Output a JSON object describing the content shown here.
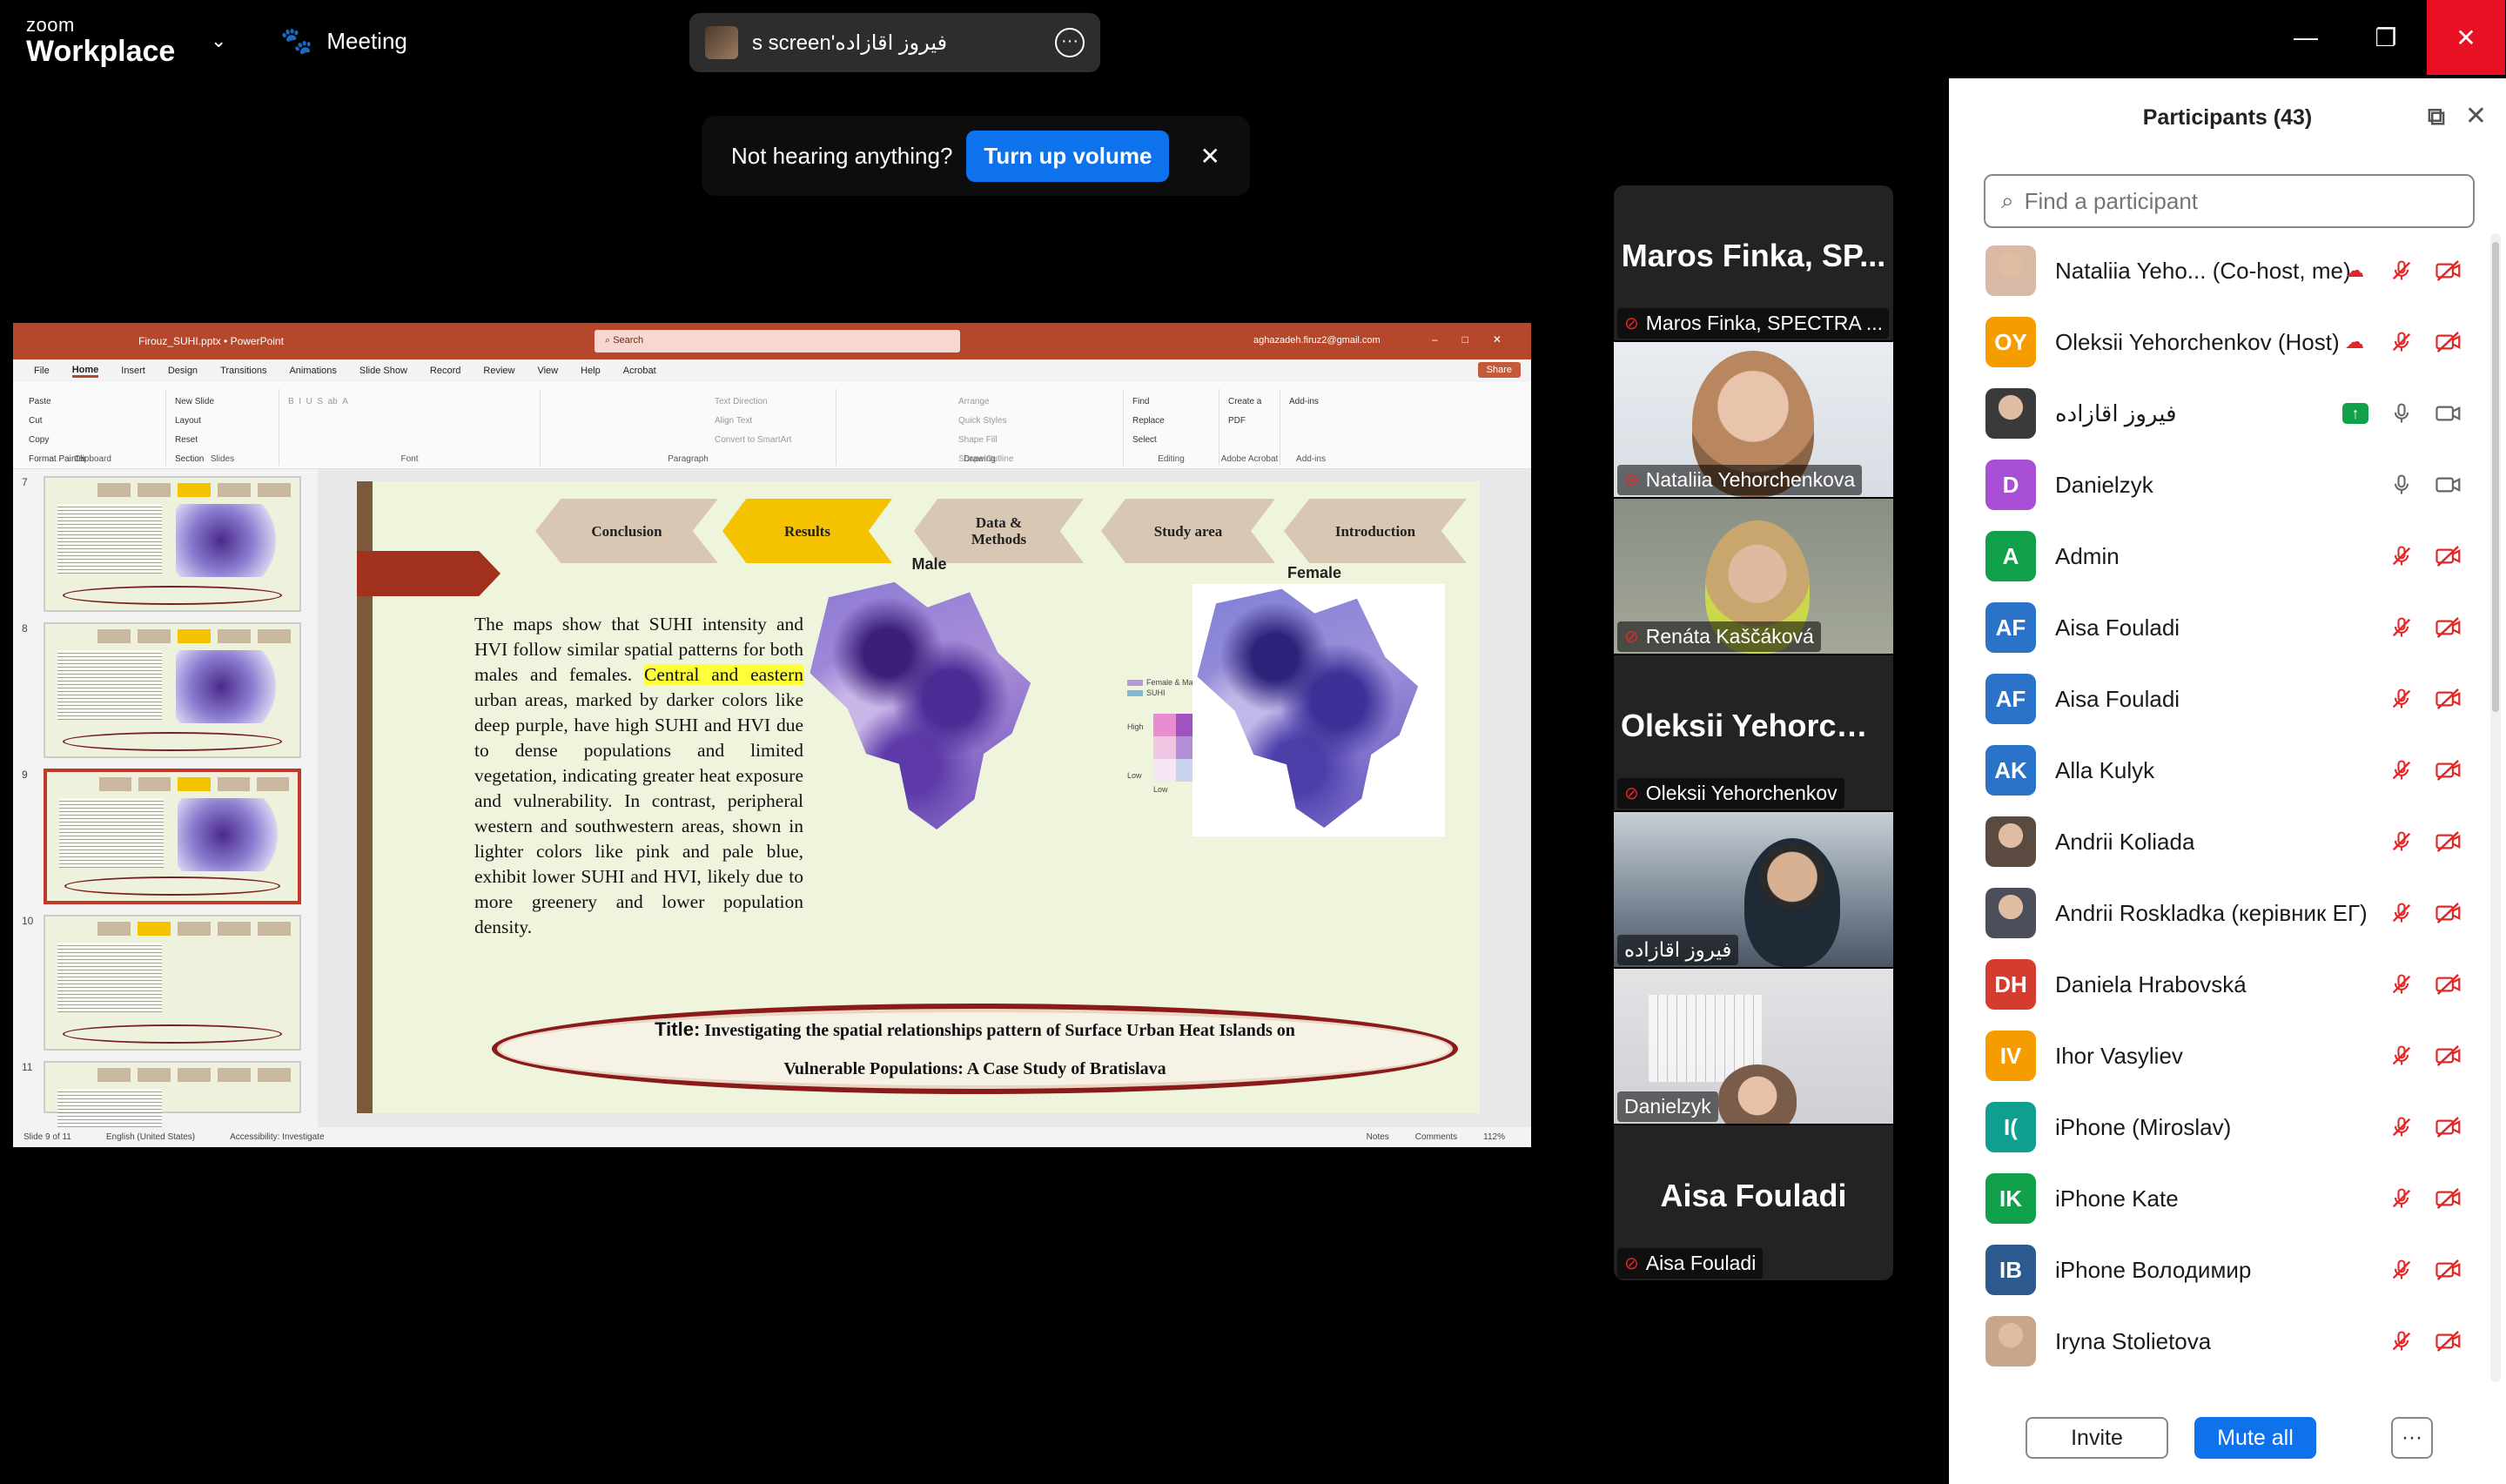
{
  "topbar": {
    "brand_small": "zoom",
    "brand_big": "Workplace",
    "meeting_label": "Meeting",
    "share_label": "فیروز اقازاده's screen",
    "more_glyph": "···"
  },
  "toast": {
    "message": "Not hearing anything?",
    "action": "Turn up volume",
    "close": "✕"
  },
  "ppt": {
    "filename": "Firouz_SUHI.pptx • PowerPoint",
    "search_placeholder": "Search",
    "account": "aghazadeh.firuz2@gmail.com",
    "share": "Share",
    "menu": [
      "File",
      "Home",
      "Insert",
      "Design",
      "Transitions",
      "Animations",
      "Slide Show",
      "Record",
      "Review",
      "View",
      "Help",
      "Acrobat"
    ],
    "ribbon": {
      "clipboard": {
        "label": "Clipboard",
        "items": [
          "Paste",
          "Cut",
          "Copy",
          "Format Painter"
        ]
      },
      "slides": {
        "label": "Slides",
        "items": [
          "New Slide",
          "Layout",
          "Reset",
          "Section"
        ]
      },
      "font": {
        "label": "Font"
      },
      "paragraph": {
        "label": "Paragraph",
        "items": [
          "Text Direction",
          "Align Text",
          "Convert to SmartArt"
        ]
      },
      "drawing": {
        "label": "Drawing",
        "items": [
          "Arrange",
          "Quick Styles",
          "Shape Fill",
          "Shape Outline",
          "Shape Effects"
        ]
      },
      "editing": {
        "label": "Editing",
        "items": [
          "Find",
          "Replace",
          "Select"
        ]
      },
      "acrobat": {
        "label": "Adobe Acrobat",
        "items": [
          "Create a PDF"
        ]
      },
      "addins": {
        "label": "Add-ins",
        "items": [
          "Add-ins"
        ]
      }
    },
    "thumb_numbers": [
      "7",
      "8",
      "9",
      "10",
      "11"
    ],
    "slide": {
      "tabs": [
        "Conclusion",
        "Results",
        "Data & Methods",
        "Study area",
        "Introduction"
      ],
      "body_before": "The maps show that SUHI intensity and HVI follow similar spatial patterns for both males and females. ",
      "body_highlight": "Central and eastern",
      "body_after": " urban areas, marked by darker colors like deep purple, have high SUHI and HVI due to dense populations and limited vegetation, indicating greater heat exposure and vulnerability. In contrast, peripheral western and southwestern areas, shown in lighter colors like pink and pale blue, exhibit lower SUHI and HVI, likely due to more greenery and lower population density.",
      "map_male": "Male",
      "map_female": "Female",
      "legend_a": "Female & Male",
      "legend_b": "SUHI",
      "legend_high": "High",
      "legend_low": "Low",
      "title_key": "Title:",
      "title_line1": "Investigating the spatial relationships pattern of Surface Urban Heat Islands on",
      "title_line2": "Vulnerable Populations: A Case Study of Bratislava"
    },
    "status": {
      "slide": "Slide 9 of 11",
      "lang": "English (United States)",
      "access": "Accessibility: Investigate",
      "notes": "Notes",
      "comments": "Comments",
      "zoom": "112%"
    }
  },
  "tiles": [
    {
      "big": "Maros Finka, SP...",
      "name": "Maros Finka, SPECTRA ...",
      "muted": true
    },
    {
      "name": "Nataliia Yehorchenkova",
      "muted": true
    },
    {
      "name": "Renáta Kaščáková",
      "muted": true
    },
    {
      "big": "Oleksii  Yehorche...",
      "name": "Oleksii Yehorchenkov",
      "muted": true
    },
    {
      "name": "فیروز اقازاده",
      "muted": false
    },
    {
      "name": "Danielzyk",
      "muted": false
    },
    {
      "big": "Aisa Fouladi",
      "name": "Aisa Fouladi",
      "muted": true
    }
  ],
  "panel": {
    "title": "Participants (43)",
    "search_placeholder": "Find a participant",
    "invite": "Invite",
    "mute_all": "Mute all",
    "more": "···",
    "participants": [
      {
        "name": "Nataliia Yeho...  (Co-host, me)",
        "initials": "",
        "color": "#d7b9a5",
        "photo": true,
        "extra": "cloud",
        "mic": "muted",
        "cam": "off"
      },
      {
        "name": "Oleksii Yehorchenkov (Host)",
        "initials": "OY",
        "color": "#f59c00",
        "extra": "cloud",
        "mic": "muted",
        "cam": "off"
      },
      {
        "name": "فیروز اقازاده",
        "initials": "",
        "color": "#3a3a3a",
        "photo": true,
        "extra": "share",
        "mic": "on",
        "cam": "on"
      },
      {
        "name": "Danielzyk",
        "initials": "D",
        "color": "#a94fd6",
        "mic": "on",
        "cam": "on"
      },
      {
        "name": "Admin",
        "initials": "A",
        "color": "#12a14b",
        "mic": "muted",
        "cam": "off"
      },
      {
        "name": "Aisa Fouladi",
        "initials": "AF",
        "color": "#2b72c9",
        "mic": "muted",
        "cam": "off"
      },
      {
        "name": "Aisa Fouladi",
        "initials": "AF",
        "color": "#2b72c9",
        "mic": "muted",
        "cam": "off"
      },
      {
        "name": "Alla Kulyk",
        "initials": "AK",
        "color": "#2b72c9",
        "mic": "muted",
        "cam": "off"
      },
      {
        "name": "Andrii Koliada",
        "initials": "",
        "color": "#5a4a40",
        "photo": true,
        "mic": "muted",
        "cam": "off"
      },
      {
        "name": "Andrii Roskladka (керівник ЕГ)",
        "initials": "",
        "color": "#4a4f5a",
        "photo": true,
        "mic": "muted",
        "cam": "off"
      },
      {
        "name": "Daniela Hrabovská",
        "initials": "DH",
        "color": "#d63b2f",
        "mic": "muted",
        "cam": "off"
      },
      {
        "name": "Ihor Vasyliev",
        "initials": "IV",
        "color": "#f59c00",
        "mic": "muted",
        "cam": "off"
      },
      {
        "name": "iPhone (Miroslav)",
        "initials": "I(",
        "color": "#0e9f8f",
        "mic": "muted",
        "cam": "off"
      },
      {
        "name": "iPhone Kate",
        "initials": "IK",
        "color": "#12a14b",
        "mic": "muted",
        "cam": "off"
      },
      {
        "name": "iPhone Володимир",
        "initials": "IB",
        "color": "#2d5a8e",
        "mic": "muted",
        "cam": "off"
      },
      {
        "name": "Iryna Stolietova",
        "initials": "",
        "color": "#c9a58a",
        "photo": true,
        "mic": "muted",
        "cam": "off"
      }
    ]
  }
}
